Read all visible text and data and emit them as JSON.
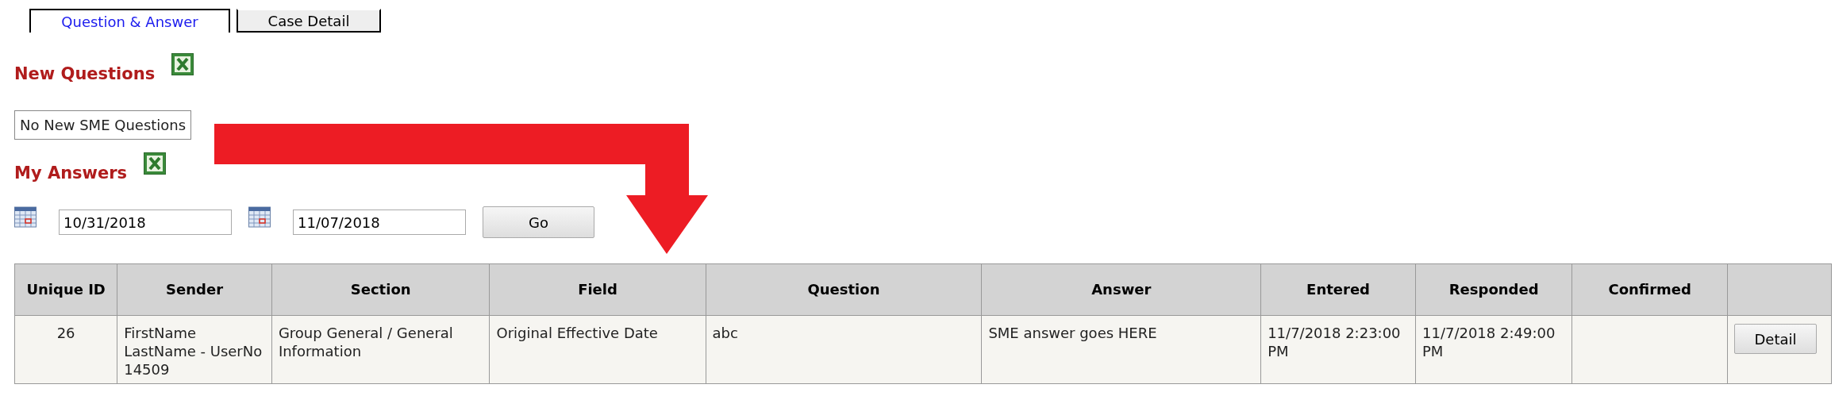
{
  "tabs": [
    {
      "label": "Question & Answer",
      "selected": true
    },
    {
      "label": "Case Detail",
      "selected": false
    }
  ],
  "new_questions": {
    "heading": "New Questions",
    "message": "No New SME Questions"
  },
  "my_answers": {
    "heading": "My Answers",
    "from_date": "10/31/2018",
    "to_date": "11/07/2018",
    "go_button": "Go"
  },
  "table": {
    "columns": [
      "Unique ID",
      "Sender",
      "Section",
      "Field",
      "Question",
      "Answer",
      "Entered",
      "Responded",
      "Confirmed"
    ],
    "rows": [
      {
        "cells": [
          "26",
          "FirstName LastName - UserNo 14509",
          "Group General / General Information",
          "Original Effective Date",
          "abc",
          "SME answer goes HERE",
          "11/7/2018 2:23:00 PM",
          "11/7/2018 2:49:00 PM",
          ""
        ],
        "button": "Detail"
      }
    ]
  }
}
